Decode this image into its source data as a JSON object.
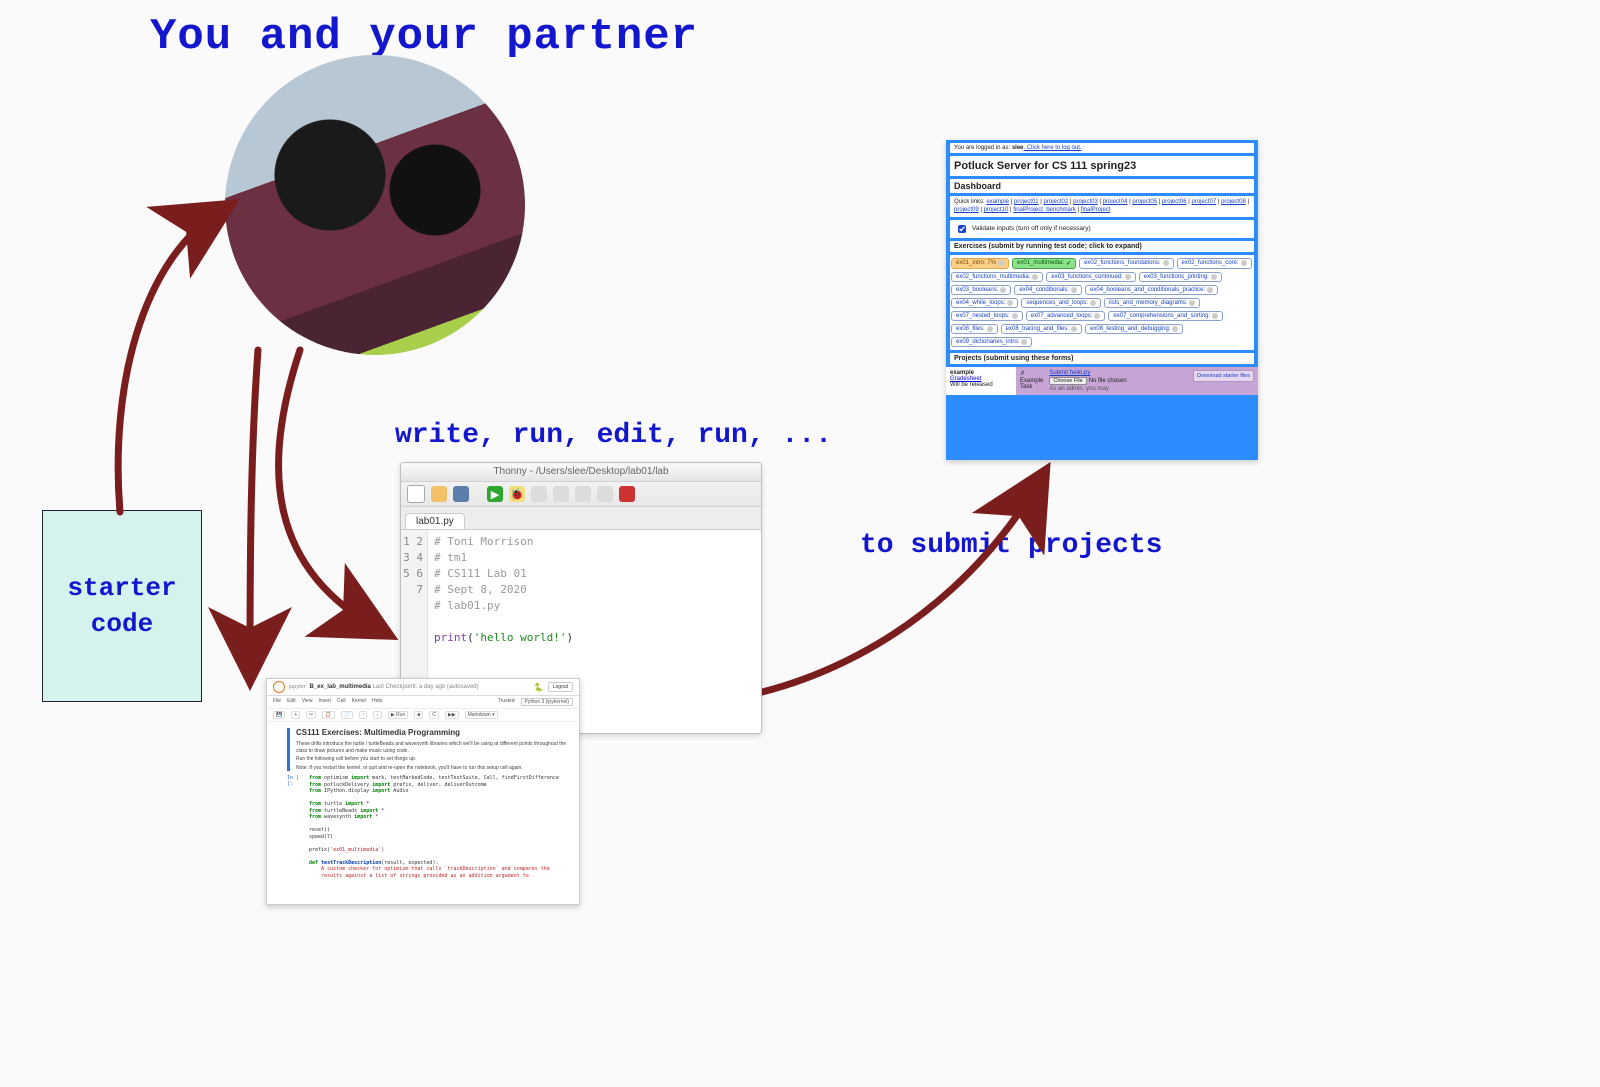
{
  "captions": {
    "partner": "You and your partner",
    "write": "write, run, edit, run, ...",
    "submit": "to submit projects",
    "starter": "starter\ncode"
  },
  "thonny": {
    "title": "Thonny  -  /Users/slee/Desktop/lab01/lab",
    "tab": "lab01.py",
    "lines": [
      "1",
      "2",
      "3",
      "4",
      "5",
      "6",
      "7"
    ],
    "comments": [
      "# Toni Morrison",
      "# tm1",
      "# CS111 Lab 01",
      "# Sept 8, 2020",
      "# lab01.py"
    ],
    "print_fn": "print",
    "print_str": "'hello world!'"
  },
  "jupyter": {
    "brand": "jupyter",
    "title": "B_ex_lab_multimedia",
    "checkpoint": "Last Checkpoint: a day ago  (autosaved)",
    "logout": "Logout",
    "menu": [
      "File",
      "Edit",
      "View",
      "Insert",
      "Cell",
      "Kernel",
      "Help"
    ],
    "trusted": "Trusted",
    "kernel": "Python 3 (ipykernel)",
    "toolbar": [
      "💾",
      "+",
      "✂",
      "📋",
      "📄",
      "↑",
      "↓",
      "▶ Run",
      "■",
      "C",
      "▶▶",
      "Markdown ▾"
    ],
    "heading": "CS111 Exercises: Multimedia Programming",
    "intro1": "These drills introduce the turtle / turtleBeads and wavesynth libraries which we'll be using at different points throughout the class to draw pictures and make music using code.",
    "intro2": "Run the following cell before you start to set things up.",
    "intro3": "Note: if you restart the kernel, or quit and re-open the notebook, you'll have to run this setup cell again.",
    "prompt": "In [ ]:",
    "code": {
      "l1a": "from",
      "l1b": "optimism",
      "l1c": "import",
      "l1d": "mark, testMarkedCode, testTestSuite, Call, findFirstDifference",
      "l2a": "from",
      "l2b": "potluckDelivery",
      "l2c": "import",
      "l2d": "prefix, deliver, deliverOutcome",
      "l3a": "from",
      "l3b": "IPython.display",
      "l3c": "import",
      "l3d": "Audio",
      "l4a": "from",
      "l4b": "turtle",
      "l4c": "import",
      "l4d": "*",
      "l5a": "from",
      "l5b": "turtleBeads",
      "l5c": "import",
      "l5d": "*",
      "l6a": "from",
      "l5b2": "wavesynth",
      "l6c": "import",
      "l6d": "*",
      "reset": "reset()",
      "speed": "speed(7)",
      "prefix": "prefix(",
      "prefix_arg": "'ex01_multimedia'",
      "prefix_end": ")",
      "def": "def",
      "defname": "testTrackDescription",
      "defargs": "(result, expected):",
      "doc1": "A custom checker for optimism that calls `trackDescription` and compares the",
      "doc2": "results against a list of strings provided as an addition argument to"
    }
  },
  "potluck": {
    "login_prefix": "You are logged in as: ",
    "login_user": "slee",
    "login_logout": ". Click here to log out.",
    "title": "Potluck Server for CS 111 spring23",
    "dashboard": "Dashboard",
    "quick_prefix": "Quick links: ",
    "quick_links": [
      "example",
      "project01",
      "project02",
      "project03",
      "project04",
      "project05",
      "project06",
      "project07",
      "project08",
      "project09",
      "project10",
      "finalProject_benchmark",
      "finalProject"
    ],
    "validate": "Validate inputs (turn off only if necessary)",
    "exercises_header": "Exercises (submit by running test code; click to expand)",
    "exercises": [
      {
        "label": "ex01_intro: 7%",
        "variant": "orange"
      },
      {
        "label": "ex01_multimedia: ",
        "variant": "green",
        "check": true
      },
      {
        "label": "ex02_functions_foundations:",
        "variant": ""
      },
      {
        "label": "ex02_functions_core:",
        "variant": ""
      },
      {
        "label": "ex02_functions_multimedia:",
        "variant": ""
      },
      {
        "label": "ex03_functions_continued:",
        "variant": ""
      },
      {
        "label": "ex03_functions_printing:",
        "variant": ""
      },
      {
        "label": "ex03_booleans:",
        "variant": ""
      },
      {
        "label": "ex04_conditionals:",
        "variant": ""
      },
      {
        "label": "ex04_booleans_and_conditionals_practice:",
        "variant": ""
      },
      {
        "label": "ex04_while_loops:",
        "variant": ""
      },
      {
        "label": "sequences_and_loops:",
        "variant": ""
      },
      {
        "label": "lists_and_memory_diagrams:",
        "variant": ""
      },
      {
        "label": "ex07_nested_loops:",
        "variant": ""
      },
      {
        "label": "ex07_advanced_loops:",
        "variant": ""
      },
      {
        "label": "ex07_comprehensions_and_sorting:",
        "variant": ""
      },
      {
        "label": "ex08_files:",
        "variant": ""
      },
      {
        "label": "ex08_tracing_and_files:",
        "variant": ""
      },
      {
        "label": "ex08_testing_and_debugging:",
        "variant": ""
      },
      {
        "label": "ex09_dictionaries_intro:",
        "variant": ""
      }
    ],
    "projects_header": "Projects (submit using these forms)",
    "proj_example": "example",
    "proj_gradesheet": "Gradesheet",
    "proj_released": "Will be released",
    "proj_star": "✗",
    "proj_example_task": "Example\nTask",
    "proj_submit": "Submit hello.py",
    "proj_choose": "Choose File",
    "proj_nofile": "No file chosen",
    "proj_admin": "As an admin, you may",
    "proj_download": "Download starter files"
  }
}
